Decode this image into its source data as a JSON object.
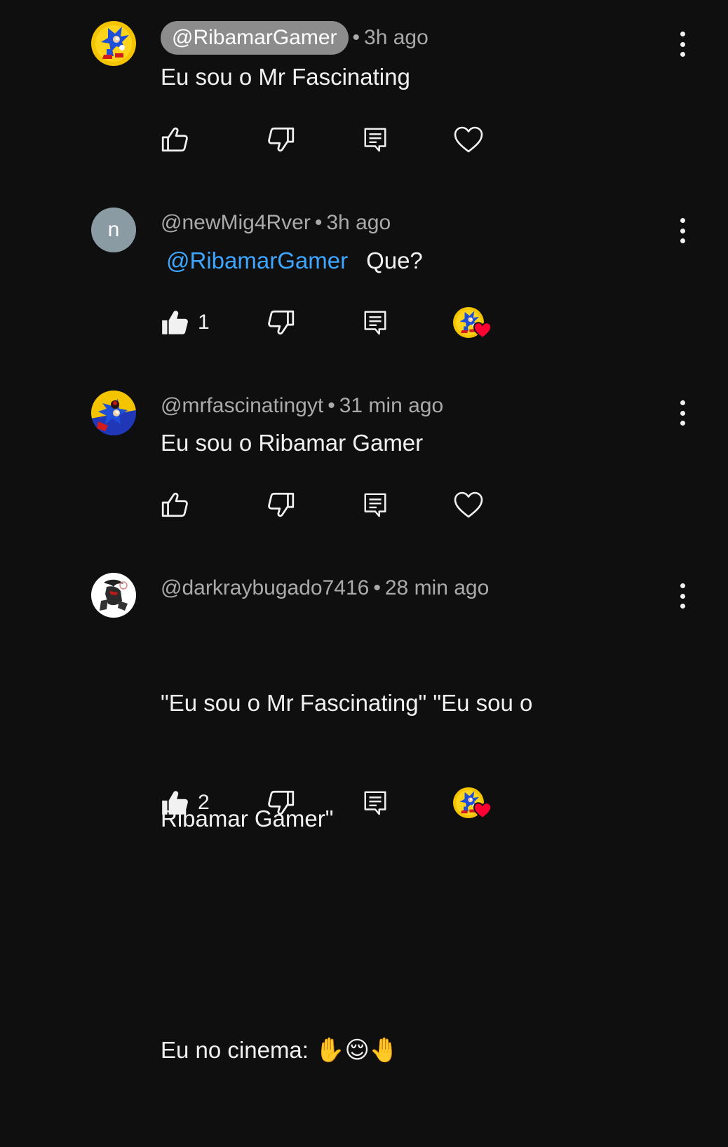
{
  "comments": [
    {
      "author": "@RibamarGamer",
      "time": "3h ago",
      "separator": "•",
      "text": "Eu sou o Mr Fascinating",
      "likes": "",
      "hearted": false
    },
    {
      "author": "@newMig4Rver",
      "avatar_letter": "n",
      "time": "3h ago",
      "separator": "•",
      "mention": "@RibamarGamer",
      "text": "Que?",
      "likes": "1",
      "hearted": true
    },
    {
      "author": "@mrfascinatingyt",
      "time": "31 min ago",
      "separator": "•",
      "text": "Eu sou o Ribamar Gamer",
      "likes": "",
      "hearted": false
    },
    {
      "author": "@darkraybugado7416",
      "time": "28 min ago",
      "separator": "•",
      "text_line1": "\"Eu sou o Mr Fascinating\" \"Eu sou o",
      "text_line2": "Ribamar Gamer\"",
      "text_line3": "Eu no cinema: ",
      "emojis": "✋😌🤚",
      "likes": "2",
      "hearted": true
    }
  ],
  "colors": {
    "background": "#0f0f0f",
    "text": "#f1f1f1",
    "secondary": "#aaaaaa",
    "mention": "#3ea6ff",
    "heart": "#ff0033",
    "pill": "#8c8c8c"
  },
  "icons": [
    "like-icon",
    "dislike-icon",
    "reply-icon",
    "heart-icon",
    "more-vert-icon"
  ]
}
